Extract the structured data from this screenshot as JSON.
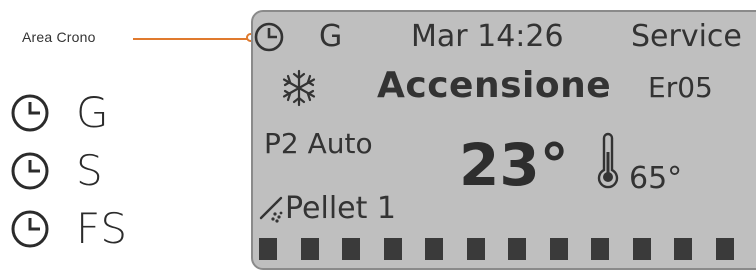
{
  "callout": {
    "label": "Area Crono"
  },
  "legend": [
    {
      "icon": "clock-icon",
      "label": "G"
    },
    {
      "icon": "clock-icon",
      "label": "S"
    },
    {
      "icon": "clock-icon",
      "label": "FS"
    }
  ],
  "display": {
    "program_mode": "G",
    "datetime": "Mar 14:26",
    "service_label": "Service",
    "mode_icon": "snowflake-icon",
    "state": "Accensione",
    "error_code": "Er05",
    "power_mode": "P2 Auto",
    "room_temp": "23°",
    "water_temp": "65°",
    "pellet": "Pellet 1",
    "bar_count": 12
  },
  "colors": {
    "accent": "#e07a2e",
    "panel": "#bfbfbf",
    "text": "#2b2b2b"
  }
}
